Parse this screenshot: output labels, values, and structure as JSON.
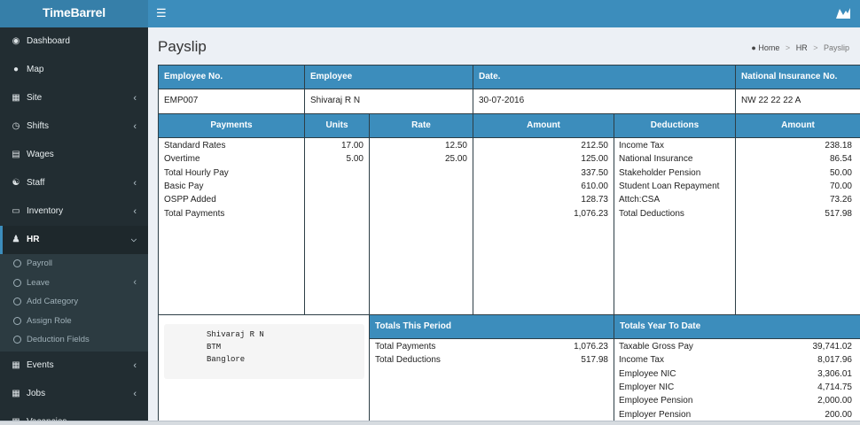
{
  "app": {
    "logo_text": "TimeBarrel"
  },
  "sidebar": {
    "items": [
      {
        "label": "Dashboard",
        "icon": "dashboard-icon",
        "chevron": false
      },
      {
        "label": "Map",
        "icon": "map-pin-icon",
        "chevron": false
      },
      {
        "label": "Site",
        "icon": "building-icon",
        "chevron": true
      },
      {
        "label": "Shifts",
        "icon": "clock-icon",
        "chevron": true
      },
      {
        "label": "Wages",
        "icon": "credit-card-icon",
        "chevron": false
      },
      {
        "label": "Staff",
        "icon": "users-icon",
        "chevron": true
      },
      {
        "label": "Inventory",
        "icon": "laptop-icon",
        "chevron": true
      },
      {
        "label": "HR",
        "icon": "user-icon",
        "chevron": true,
        "expanded": true
      },
      {
        "label": "Events",
        "icon": "calendar-icon",
        "chevron": true
      },
      {
        "label": "Jobs",
        "icon": "calendar-icon",
        "chevron": true
      },
      {
        "label": "Vacancies",
        "icon": "calendar-icon",
        "chevron": false
      }
    ],
    "hr_submenu": [
      {
        "label": "Payroll",
        "chevron": false
      },
      {
        "label": "Leave",
        "chevron": true
      },
      {
        "label": "Add Category",
        "chevron": false
      },
      {
        "label": "Assign Role",
        "chevron": false
      },
      {
        "label": "Deduction Fields",
        "chevron": false
      }
    ]
  },
  "page": {
    "title": "Payslip",
    "breadcrumb": {
      "home": "Home",
      "section": "HR",
      "current": "Payslip"
    }
  },
  "payslip": {
    "header_labels": {
      "employee_no": "Employee No.",
      "employee": "Employee",
      "date": "Date.",
      "ni": "National Insurance No."
    },
    "header_values": {
      "employee_no": "EMP007",
      "employee": "Shivaraj R N",
      "date": "30-07-2016",
      "ni": "NW 22 22 22 A"
    },
    "payments_headers": {
      "payments": "Payments",
      "units": "Units",
      "rate": "Rate",
      "amount": "Amount"
    },
    "payments": [
      {
        "label": "Standard Rates",
        "units": "17.00",
        "rate": "12.50",
        "amount": "212.50"
      },
      {
        "label": "Overtime",
        "units": "5.00",
        "rate": "25.00",
        "amount": "125.00"
      },
      {
        "label": "Total Hourly Pay",
        "units": "",
        "rate": "",
        "amount": "337.50"
      },
      {
        "label": "Basic Pay",
        "units": "",
        "rate": "",
        "amount": "610.00"
      },
      {
        "label": "OSPP Added",
        "units": "",
        "rate": "",
        "amount": "128.73"
      },
      {
        "label": "Total Payments",
        "units": "",
        "rate": "",
        "amount": "1,076.23"
      }
    ],
    "deductions_headers": {
      "deductions": "Deductions",
      "amount": "Amount"
    },
    "deductions": [
      {
        "label": "Income Tax",
        "amount": "238.18"
      },
      {
        "label": "National Insurance",
        "amount": "86.54"
      },
      {
        "label": "Stakeholder Pension",
        "amount": "50.00"
      },
      {
        "label": "Student Loan Repayment",
        "amount": "70.00"
      },
      {
        "label": "Attch:CSA",
        "amount": "73.26"
      },
      {
        "label": "Total Deductions",
        "amount": "517.98"
      }
    ],
    "address": [
      "Shivaraj R N",
      "BTM",
      "Banglore"
    ],
    "totals_period_header": "Totals This Period",
    "totals_period": [
      {
        "label": "Total Payments",
        "amount": "1,076.23"
      },
      {
        "label": "Total Deductions",
        "amount": "517.98"
      }
    ],
    "totals_ytd_header": "Totals Year To Date",
    "totals_ytd": [
      {
        "label": "Taxable Gross Pay",
        "amount": "39,741.02"
      },
      {
        "label": "Income Tax",
        "amount": "8,017.96"
      },
      {
        "label": "Employee NIC",
        "amount": "3,306.01"
      },
      {
        "label": "Employer NIC",
        "amount": "4,714.75"
      },
      {
        "label": "Employee Pension",
        "amount": "2,000.00"
      },
      {
        "label": "Employer Pension",
        "amount": "200.00"
      }
    ]
  }
}
